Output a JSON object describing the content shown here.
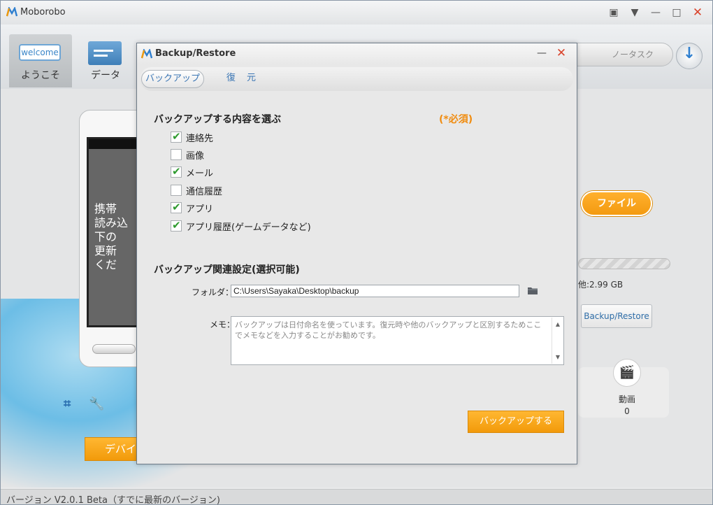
{
  "app": {
    "title": "Moborobo",
    "titlebar_icons": [
      "feedback-icon",
      "menu-icon",
      "minimize-icon",
      "maximize-icon",
      "close-icon"
    ]
  },
  "toolbar": {
    "items": [
      {
        "label": "ようこそ",
        "icon_text": "welcome"
      },
      {
        "label": "データ"
      }
    ],
    "task_label": "ノータスク"
  },
  "main": {
    "phone_text": "携帯\n読み込\n下の\n更新\nくだ",
    "file_button": "ファイル",
    "storage_text": "他:2.99 GB",
    "backup_restore_button": "Backup/Restore",
    "video": {
      "label": "動画",
      "count": "0"
    },
    "device_button": "デバイ"
  },
  "statusbar": "バージョン V2.0.1 Beta（すでに最新のバージョン)",
  "dialog": {
    "title": "Backup/Restore",
    "tabs": [
      "バックアップ",
      "復 元"
    ],
    "select_title": "バックアップする内容を選ぶ",
    "required": "(*必須)",
    "items": [
      {
        "label": "連絡先",
        "checked": true
      },
      {
        "label": "画像",
        "checked": false
      },
      {
        "label": "メール",
        "checked": true
      },
      {
        "label": "通信履歴",
        "checked": false
      },
      {
        "label": "アプリ",
        "checked": true
      },
      {
        "label": "アプリ履歴(ゲームデータなど)",
        "checked": true
      }
    ],
    "settings_title": "バックアップ関連設定(選択可能)",
    "folder_label": "フォルダ：",
    "folder_value": "C:\\Users\\Sayaka\\Desktop\\backup",
    "memo_label": "メモ：",
    "memo_placeholder": "バックアップは日付命名を使っています。復元時や他のバックアップと区別するためここでメモなどを入力することがお勧めです。",
    "submit": "バックアップする"
  },
  "colors": {
    "accent_orange": "#f29a0a",
    "link_blue": "#3b76b4",
    "check_green": "#2e9a2e"
  }
}
